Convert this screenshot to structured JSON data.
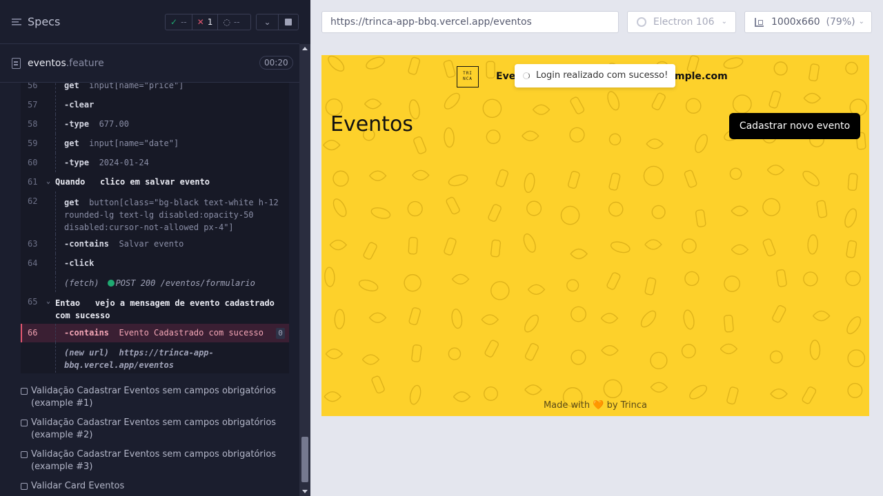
{
  "reporter": {
    "specs_title": "Specs",
    "stats": {
      "passed": "--",
      "failed": "1",
      "pending": "--"
    },
    "file": {
      "name": "eventos",
      "ext": ".feature",
      "duration": "00:20"
    },
    "commands": [
      {
        "line": "56",
        "name": "get",
        "arg": "input[name=\"price\"]"
      },
      {
        "line": "57",
        "name": "-clear",
        "arg": ""
      },
      {
        "line": "58",
        "name": "-type",
        "arg": "677.00"
      },
      {
        "line": "59",
        "name": "get",
        "arg": "input[name=\"date\"]"
      },
      {
        "line": "60",
        "name": "-type",
        "arg": "2024-01-24"
      },
      {
        "line": "61",
        "keyword": "Quando",
        "step": "clico em salvar evento"
      },
      {
        "line": "62",
        "name": "get",
        "arg": "button[class=\"bg-black text-white h-12",
        "arg2": "rounded-lg text-lg disabled:opacity-50",
        "arg3": "disabled:cursor-not-allowed px-4\"]"
      },
      {
        "line": "63",
        "name": "-contains",
        "arg": "Salvar evento"
      },
      {
        "line": "64",
        "name": "-click",
        "arg": ""
      },
      {
        "event": "(fetch)",
        "detail": "POST 200 /eventos/formulario"
      },
      {
        "line": "65",
        "keyword": "Entao",
        "step": "vejo a mensagem de evento cadastrado",
        "step2": "com sucesso"
      },
      {
        "line": "66",
        "name": "-contains",
        "arg": "Evento Cadastrado com sucesso",
        "badge": "0"
      },
      {
        "event": "(new url)",
        "detail": "https://trinca-app-",
        "detail2": "bbq.vercel.app/eventos"
      }
    ],
    "tests": [
      {
        "label": "Validação Cadastrar Eventos sem campos obrigatórios",
        "label2": "(example #1)"
      },
      {
        "label": "Validação Cadastrar Eventos sem campos obrigatórios",
        "label2": "(example #2)"
      },
      {
        "label": "Validação Cadastrar Eventos sem campos obrigatórios",
        "label2": "(example #3)"
      },
      {
        "label": "Validar Card Eventos",
        "label2": ""
      }
    ]
  },
  "browser": {
    "url": "https://trinca-app-bbq.vercel.app/eventos",
    "engine": "Electron 106",
    "viewport": "1000x660",
    "scale": "(79%)"
  },
  "app": {
    "logo_text": "TRI\nNCA",
    "nav_left": "Eve",
    "nav_right": "mple.com",
    "toast": "Login realizado com sucesso!",
    "title": "Eventos",
    "new_event_button": "Cadastrar novo evento",
    "footer_pre": "Made with",
    "footer_heart": "🧡",
    "footer_post": "by Trinca"
  },
  "colors": {
    "reporter_bg": "#1b1e2e",
    "pass": "#1fa971",
    "fail": "#e45770",
    "app_bg": "#fdd12b"
  }
}
